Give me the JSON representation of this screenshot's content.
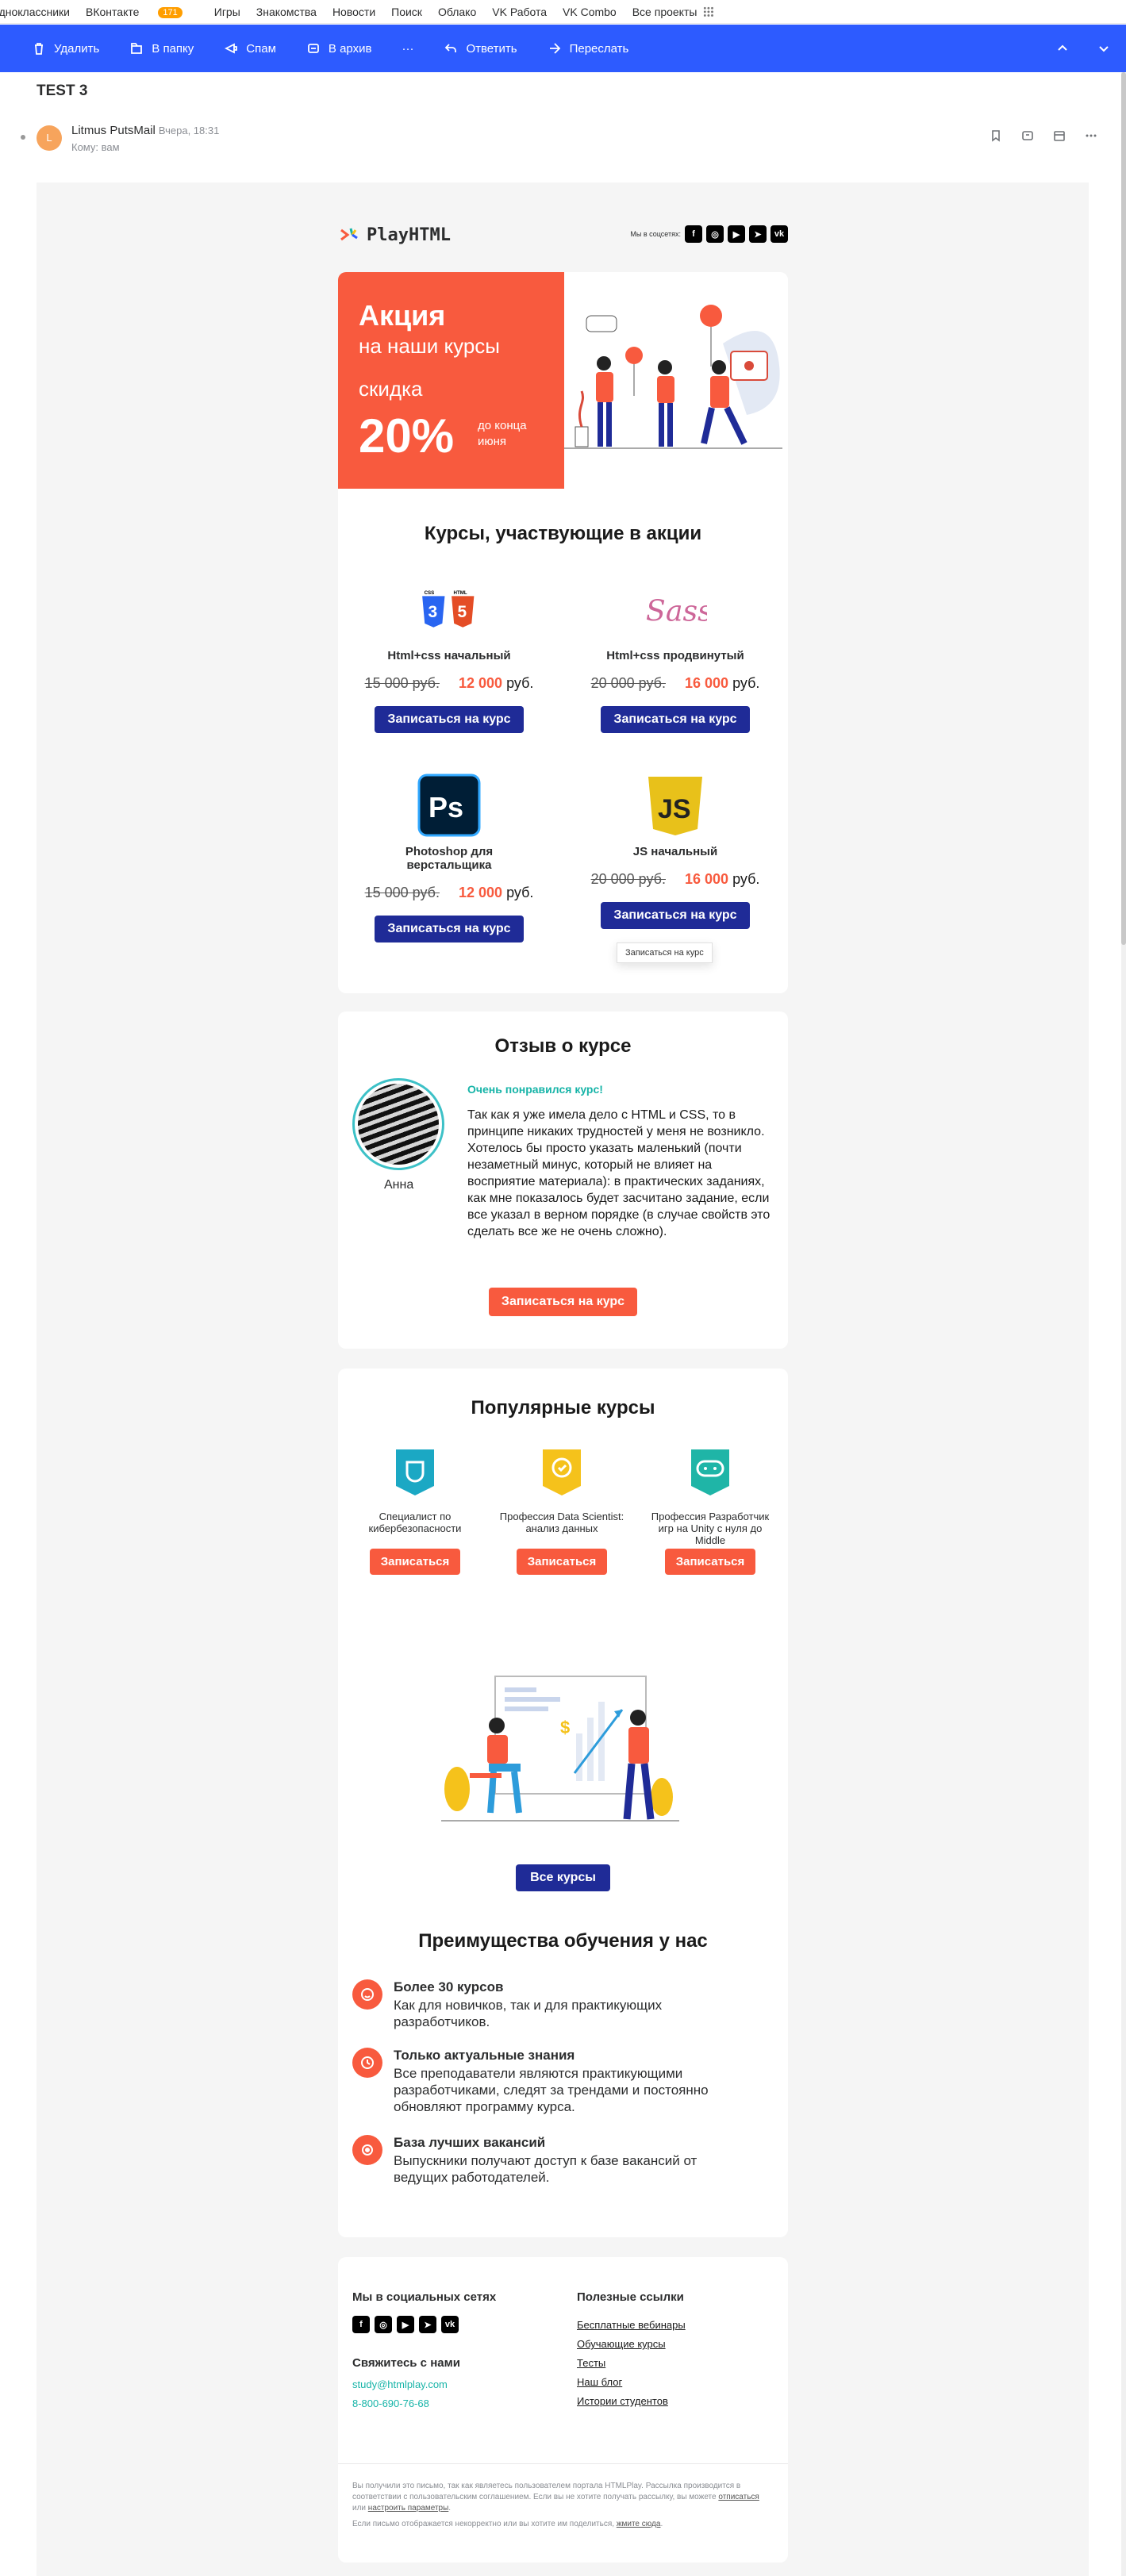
{
  "topnav": {
    "items": [
      "Одноклассники",
      "ВКонтакте",
      "Игры",
      "Знакомства",
      "Новости",
      "Поиск",
      "Облако",
      "VK Работа",
      "VK Combo",
      "Все проекты"
    ],
    "vk_badge": "171"
  },
  "toolbar": {
    "delete": "Удалить",
    "to_folder": "В папку",
    "spam": "Спам",
    "archive": "В архив",
    "more": "···",
    "reply": "Ответить",
    "forward": "Переслать"
  },
  "message": {
    "subject": "TEST 3",
    "avatar_letter": "L",
    "sender": "Litmus PutsMail",
    "time": "Вчера, 18:31",
    "to": "Кому: вам"
  },
  "email": {
    "logo": "PlayHTML",
    "social_label": "Мы в соцсетях:",
    "banner": {
      "line1": "Акция",
      "line2": "на наши курсы",
      "line3": "скидка",
      "percent": "20%",
      "until": "до конца июня"
    },
    "courses_heading": "Курсы, участвующие в акции",
    "courses": [
      {
        "title": "Html+css начальный",
        "old_price": "15 000 руб.",
        "new_price": "12 000",
        "currency": "руб.",
        "button": "Записаться на курс",
        "icon": "css-html-icon"
      },
      {
        "title": "Html+css продвинутый",
        "old_price": "20 000 руб.",
        "new_price": "16 000",
        "currency": "руб.",
        "button": "Записаться на курс",
        "icon": "sass-icon"
      },
      {
        "title": "Photoshop для верстальщика",
        "old_price": "15 000 руб.",
        "new_price": "12 000",
        "currency": "руб.",
        "button": "Записаться на курс",
        "icon": "photoshop-icon"
      },
      {
        "title": "JS начальный",
        "old_price": "20 000 руб.",
        "new_price": "16 000",
        "currency": "руб.",
        "button": "Записаться на курс",
        "icon": "js-icon"
      }
    ],
    "tooltip": "Записаться на курс",
    "review": {
      "heading": "Отзыв о курсе",
      "name": "Анна",
      "headline": "Очень понравился курс!",
      "text": "Так как я уже имела дело с HTML и CSS, то в принципе никаких трудностей у меня не возникло. Хотелось бы просто указать маленький (почти незаметный минус, который не влияет на восприятие материала): в практических заданиях, как мне показалось будет засчитано задание, если все указал в верном порядке (в случае свойств это сделать все же не очень сложно).",
      "button": "Записаться на курс"
    },
    "popular": {
      "heading": "Популярные курсы",
      "items": [
        {
          "title": "Специалист по кибербезопасности",
          "button": "Записаться",
          "color": "#1ba8c4"
        },
        {
          "title": "Профессия Data Scientist: анализ данных",
          "button": "Записаться",
          "color": "#f5c21b"
        },
        {
          "title": "Профессия Разработчик игр на Unity с нуля до Middle",
          "button": "Записаться",
          "color": "#1fb5a7"
        }
      ],
      "all_button": "Все курсы"
    },
    "advantages": {
      "heading": "Преимущества обучения у нас",
      "items": [
        {
          "title": "Более 30 курсов",
          "text": "Как для новичков, так и для практикующих разработчиков."
        },
        {
          "title": "Только актуальные знания",
          "text": "Все преподаватели являются практикующими разработчиками, следят за трендами и постоянно обновляют программу курса."
        },
        {
          "title": "База лучших вакансий",
          "text": "Выпускники получают доступ к базе вакансий от ведущих работодателей."
        }
      ]
    },
    "footer": {
      "social_heading": "Мы в социальных сетях",
      "contact_heading": "Свяжитесь с нами",
      "email": "study@htmlplay.com",
      "phone": "8-800-690-76-68",
      "links_heading": "Полезные ссылки",
      "links": [
        "Бесплатные вебинары",
        "Обучающие курсы",
        "Тесты",
        "Наш блог",
        "Истории студентов"
      ],
      "legal1_a": "Вы получили это письмо, так как являетесь пользователем портала HTMLPlay. Рассылка производится в соответствии с пользовательским соглашением. Если вы не хотите получать рассылку, вы можете",
      "legal1_unsub": "отписаться",
      "legal1_or": "или",
      "legal1_settings": "настроить параметры",
      "legal2_a": "Если письмо отображается некорректно или вы хотите им поделиться,",
      "legal2_link": "жмите сюда"
    }
  },
  "colors": {
    "accent_blue": "#2d5bff",
    "brand_red": "#f85a3e",
    "button_navy": "#1f2b97",
    "teal": "#17b4a8"
  }
}
